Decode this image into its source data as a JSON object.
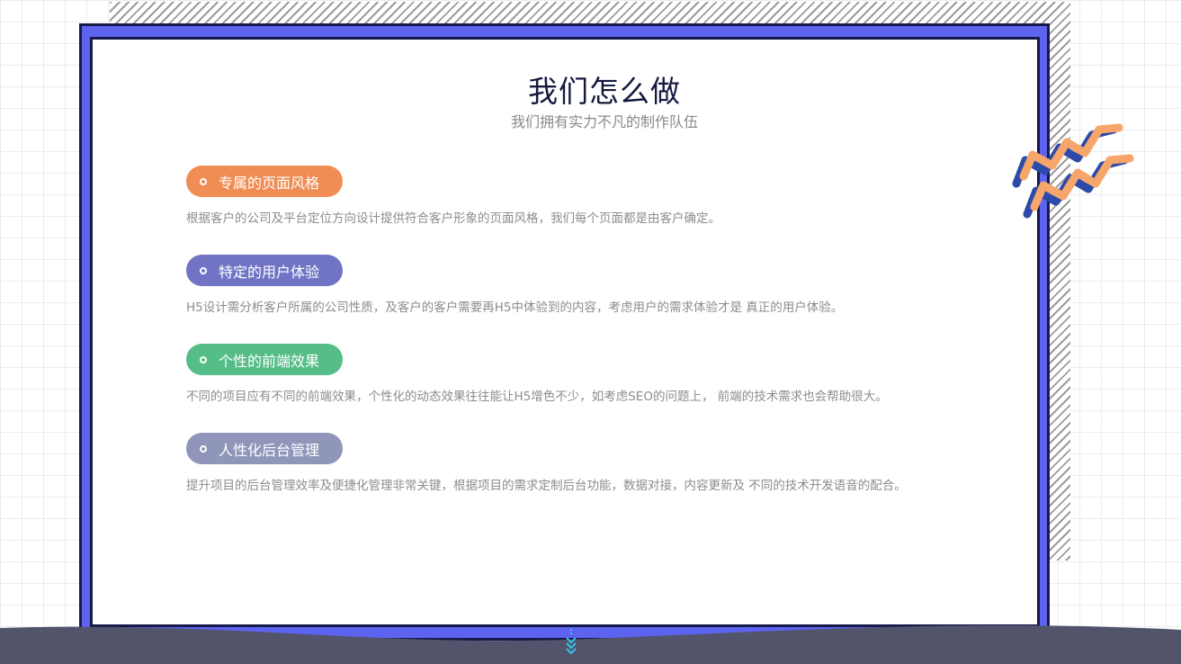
{
  "header": {
    "title": "我们怎么做",
    "subtitle": "我们拥有实力不凡的制作队伍"
  },
  "items": [
    {
      "label": "专属的页面风格",
      "description": "根据客户的公司及平台定位方向设计提供符合客户形象的页面风格，我们每个页面都是由客户确定。",
      "color": "#f08d55"
    },
    {
      "label": "特定的用户体验",
      "description": "H5设计需分析客户所属的公司性质，及客户的客户需要再H5中体验到的内容，考虑用户的需求体验才是 真正的用户体验。",
      "color": "#7174c4"
    },
    {
      "label": "个性的前端效果",
      "description": "不同的项目应有不同的前端效果，个性化的动态效果往往能让H5增色不少，如考虑SEO的问题上， 前端的技术需求也会帮助很大。",
      "color": "#55bd88"
    },
    {
      "label": "人性化后台管理",
      "description": "提升项目的后台管理效率及便捷化管理非常关键，根据项目的需求定制后台功能，数据对接，内容更新及 不同的技术开发语音的配合。",
      "color": "#8f96ba"
    }
  ],
  "decor": {
    "frame_color": "#5d63ee",
    "wave_color": "#52546c",
    "zigzag_colors": [
      "#f6a66a",
      "#2e4aa8"
    ],
    "scroll_icon": "chevron-down-icon"
  }
}
